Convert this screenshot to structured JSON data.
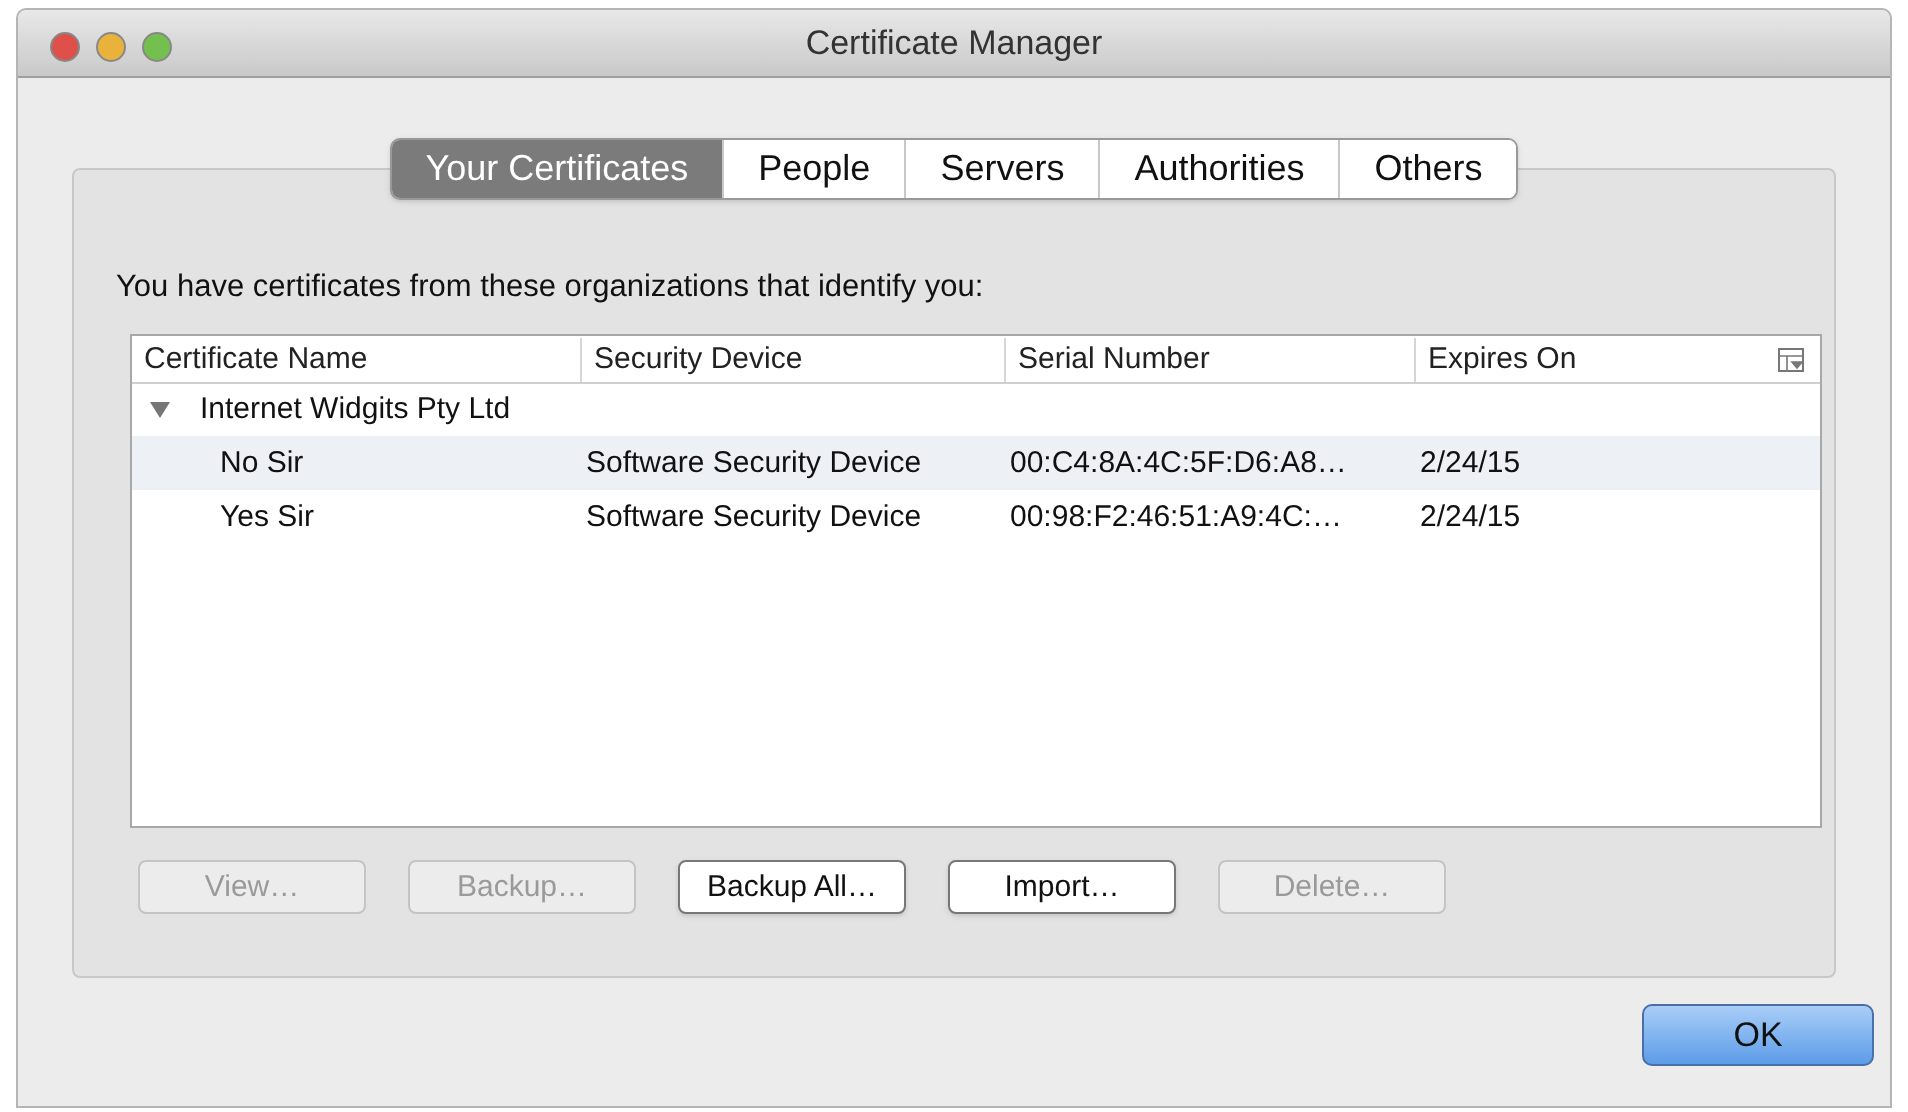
{
  "window": {
    "title": "Certificate Manager"
  },
  "tabs": [
    {
      "label": "Your Certificates",
      "selected": true
    },
    {
      "label": "People",
      "selected": false
    },
    {
      "label": "Servers",
      "selected": false
    },
    {
      "label": "Authorities",
      "selected": false
    },
    {
      "label": "Others",
      "selected": false
    }
  ],
  "intro": "You have certificates from these organizations that identify you:",
  "table": {
    "columns": [
      "Certificate Name",
      "Security Device",
      "Serial Number",
      "Expires On"
    ],
    "rows": [
      {
        "name": "Internet Widgits Pty Ltd",
        "expanded": true,
        "children": [
          {
            "cells": [
              "No Sir",
              "Software Security Device",
              "00:C4:8A:4C:5F:D6:A8…",
              "2/24/15"
            ]
          },
          {
            "cells": [
              "Yes Sir",
              "Software Security Device",
              "00:98:F2:46:51:A9:4C:…",
              "2/24/15"
            ]
          }
        ]
      }
    ]
  },
  "buttons": [
    {
      "label": "View…",
      "disabled": true
    },
    {
      "label": "Backup…",
      "disabled": true
    },
    {
      "label": "Backup All…",
      "disabled": false
    },
    {
      "label": "Import…",
      "disabled": false
    },
    {
      "label": "Delete…",
      "disabled": true
    }
  ],
  "ok_button": "OK"
}
